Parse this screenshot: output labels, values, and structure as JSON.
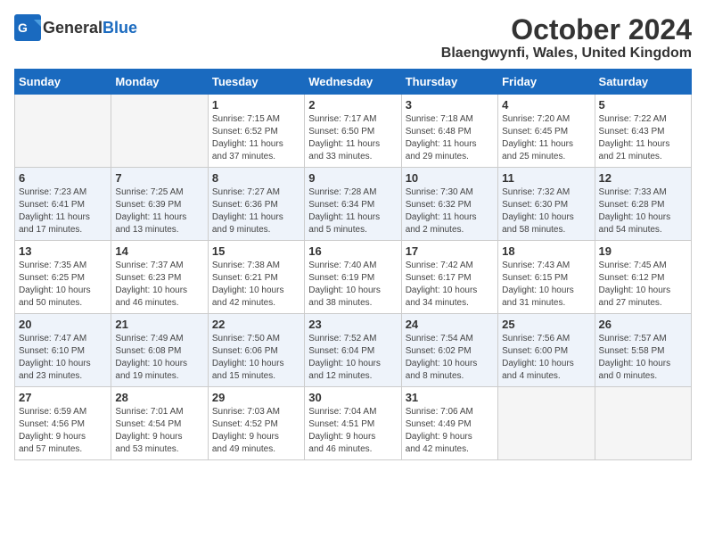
{
  "header": {
    "logo_general": "General",
    "logo_blue": "Blue",
    "month_title": "October 2024",
    "location": "Blaengwynfi, Wales, United Kingdom"
  },
  "days_of_week": [
    "Sunday",
    "Monday",
    "Tuesday",
    "Wednesday",
    "Thursday",
    "Friday",
    "Saturday"
  ],
  "weeks": [
    [
      {
        "day": "",
        "info": ""
      },
      {
        "day": "",
        "info": ""
      },
      {
        "day": "1",
        "info": "Sunrise: 7:15 AM\nSunset: 6:52 PM\nDaylight: 11 hours\nand 37 minutes."
      },
      {
        "day": "2",
        "info": "Sunrise: 7:17 AM\nSunset: 6:50 PM\nDaylight: 11 hours\nand 33 minutes."
      },
      {
        "day": "3",
        "info": "Sunrise: 7:18 AM\nSunset: 6:48 PM\nDaylight: 11 hours\nand 29 minutes."
      },
      {
        "day": "4",
        "info": "Sunrise: 7:20 AM\nSunset: 6:45 PM\nDaylight: 11 hours\nand 25 minutes."
      },
      {
        "day": "5",
        "info": "Sunrise: 7:22 AM\nSunset: 6:43 PM\nDaylight: 11 hours\nand 21 minutes."
      }
    ],
    [
      {
        "day": "6",
        "info": "Sunrise: 7:23 AM\nSunset: 6:41 PM\nDaylight: 11 hours\nand 17 minutes."
      },
      {
        "day": "7",
        "info": "Sunrise: 7:25 AM\nSunset: 6:39 PM\nDaylight: 11 hours\nand 13 minutes."
      },
      {
        "day": "8",
        "info": "Sunrise: 7:27 AM\nSunset: 6:36 PM\nDaylight: 11 hours\nand 9 minutes."
      },
      {
        "day": "9",
        "info": "Sunrise: 7:28 AM\nSunset: 6:34 PM\nDaylight: 11 hours\nand 5 minutes."
      },
      {
        "day": "10",
        "info": "Sunrise: 7:30 AM\nSunset: 6:32 PM\nDaylight: 11 hours\nand 2 minutes."
      },
      {
        "day": "11",
        "info": "Sunrise: 7:32 AM\nSunset: 6:30 PM\nDaylight: 10 hours\nand 58 minutes."
      },
      {
        "day": "12",
        "info": "Sunrise: 7:33 AM\nSunset: 6:28 PM\nDaylight: 10 hours\nand 54 minutes."
      }
    ],
    [
      {
        "day": "13",
        "info": "Sunrise: 7:35 AM\nSunset: 6:25 PM\nDaylight: 10 hours\nand 50 minutes."
      },
      {
        "day": "14",
        "info": "Sunrise: 7:37 AM\nSunset: 6:23 PM\nDaylight: 10 hours\nand 46 minutes."
      },
      {
        "day": "15",
        "info": "Sunrise: 7:38 AM\nSunset: 6:21 PM\nDaylight: 10 hours\nand 42 minutes."
      },
      {
        "day": "16",
        "info": "Sunrise: 7:40 AM\nSunset: 6:19 PM\nDaylight: 10 hours\nand 38 minutes."
      },
      {
        "day": "17",
        "info": "Sunrise: 7:42 AM\nSunset: 6:17 PM\nDaylight: 10 hours\nand 34 minutes."
      },
      {
        "day": "18",
        "info": "Sunrise: 7:43 AM\nSunset: 6:15 PM\nDaylight: 10 hours\nand 31 minutes."
      },
      {
        "day": "19",
        "info": "Sunrise: 7:45 AM\nSunset: 6:12 PM\nDaylight: 10 hours\nand 27 minutes."
      }
    ],
    [
      {
        "day": "20",
        "info": "Sunrise: 7:47 AM\nSunset: 6:10 PM\nDaylight: 10 hours\nand 23 minutes."
      },
      {
        "day": "21",
        "info": "Sunrise: 7:49 AM\nSunset: 6:08 PM\nDaylight: 10 hours\nand 19 minutes."
      },
      {
        "day": "22",
        "info": "Sunrise: 7:50 AM\nSunset: 6:06 PM\nDaylight: 10 hours\nand 15 minutes."
      },
      {
        "day": "23",
        "info": "Sunrise: 7:52 AM\nSunset: 6:04 PM\nDaylight: 10 hours\nand 12 minutes."
      },
      {
        "day": "24",
        "info": "Sunrise: 7:54 AM\nSunset: 6:02 PM\nDaylight: 10 hours\nand 8 minutes."
      },
      {
        "day": "25",
        "info": "Sunrise: 7:56 AM\nSunset: 6:00 PM\nDaylight: 10 hours\nand 4 minutes."
      },
      {
        "day": "26",
        "info": "Sunrise: 7:57 AM\nSunset: 5:58 PM\nDaylight: 10 hours\nand 0 minutes."
      }
    ],
    [
      {
        "day": "27",
        "info": "Sunrise: 6:59 AM\nSunset: 4:56 PM\nDaylight: 9 hours\nand 57 minutes."
      },
      {
        "day": "28",
        "info": "Sunrise: 7:01 AM\nSunset: 4:54 PM\nDaylight: 9 hours\nand 53 minutes."
      },
      {
        "day": "29",
        "info": "Sunrise: 7:03 AM\nSunset: 4:52 PM\nDaylight: 9 hours\nand 49 minutes."
      },
      {
        "day": "30",
        "info": "Sunrise: 7:04 AM\nSunset: 4:51 PM\nDaylight: 9 hours\nand 46 minutes."
      },
      {
        "day": "31",
        "info": "Sunrise: 7:06 AM\nSunset: 4:49 PM\nDaylight: 9 hours\nand 42 minutes."
      },
      {
        "day": "",
        "info": ""
      },
      {
        "day": "",
        "info": ""
      }
    ]
  ]
}
